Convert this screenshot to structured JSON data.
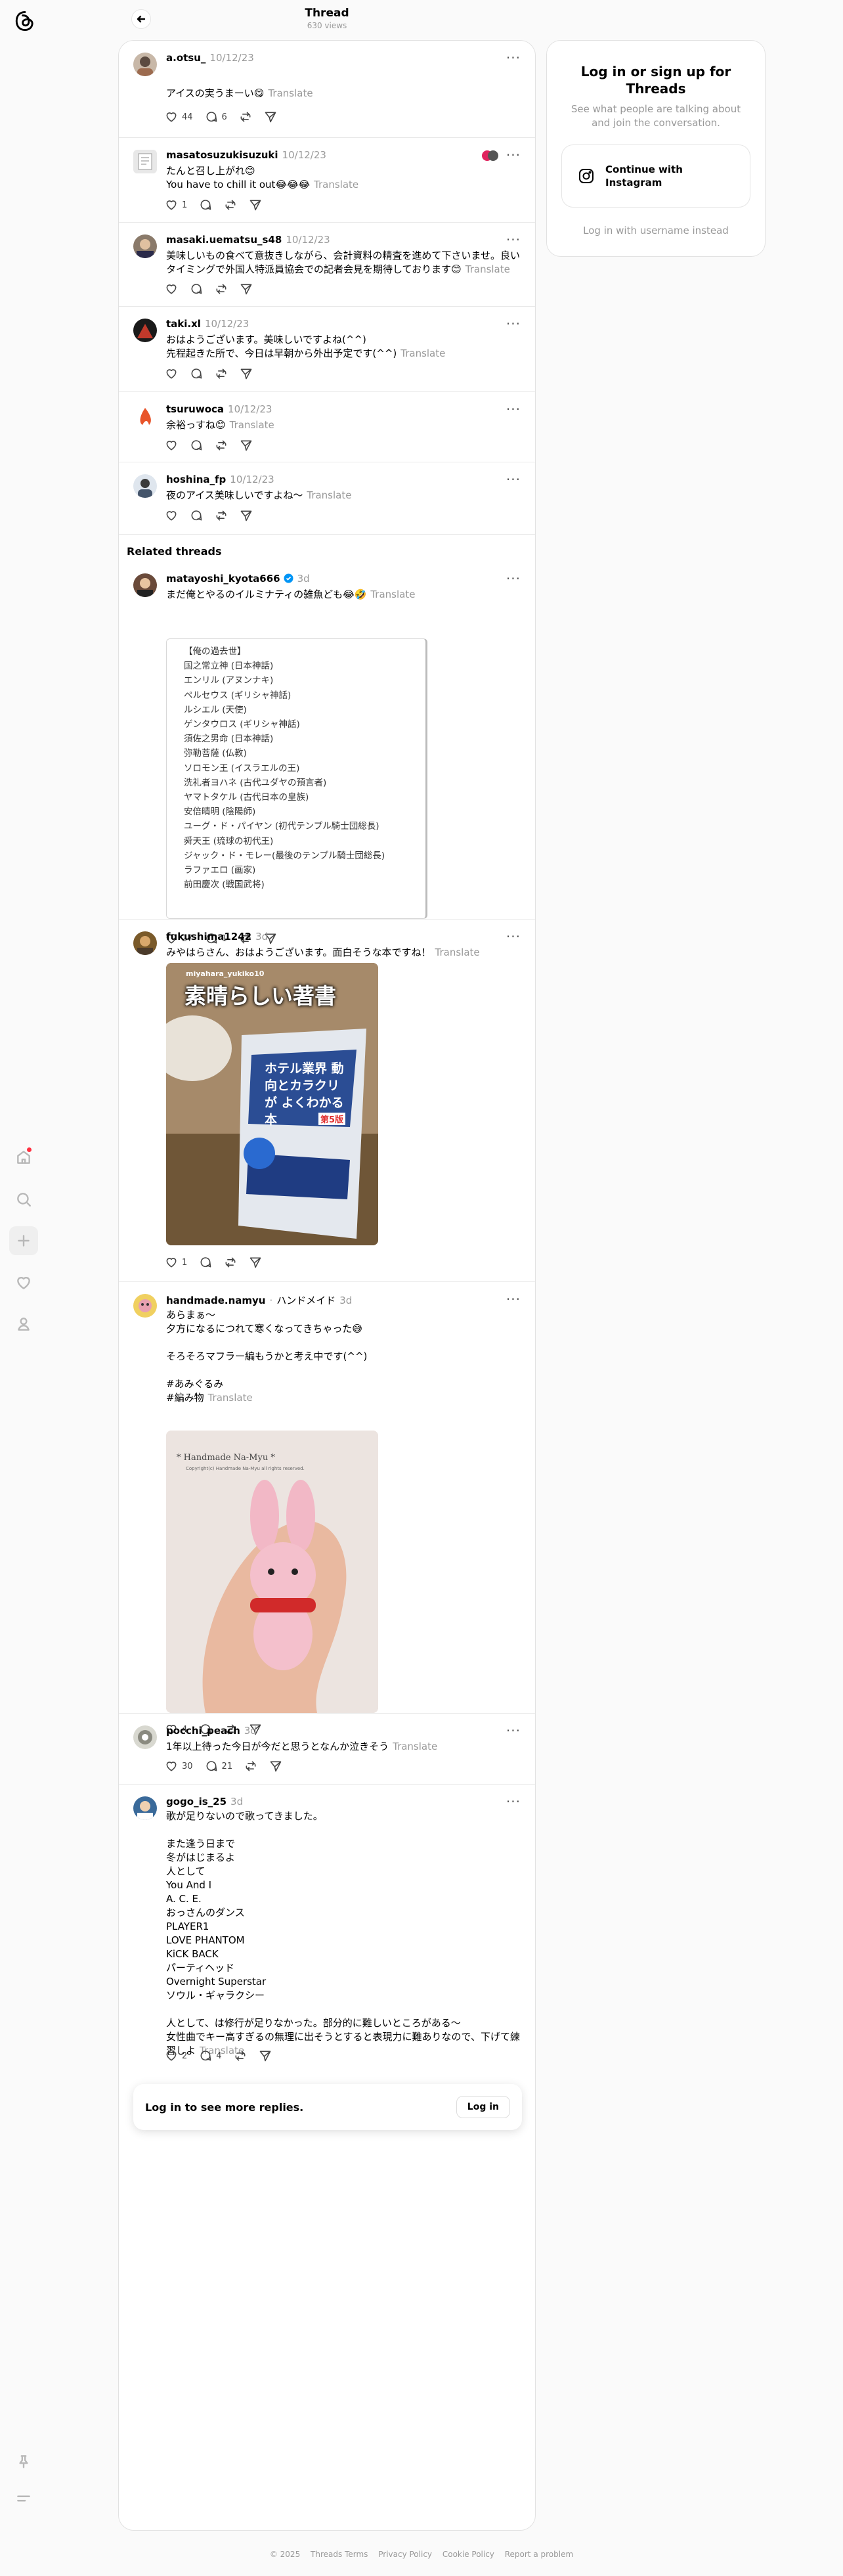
{
  "header": {
    "title": "Thread",
    "views": "630 views"
  },
  "side": {
    "title": "Log in or sign up for Threads",
    "subtitle": "See what people are talking about and join the conversation.",
    "ig_button": "Continue with Instagram",
    "alt": "Log in with username instead"
  },
  "translate": "Translate",
  "more": "···",
  "posts": [
    {
      "user": "a.otsu_",
      "date": "10/12/23",
      "text": "アイスの実うまーい😋",
      "likes": "44",
      "replies": "6"
    },
    {
      "user": "masatosuzukisuzuki",
      "date": "10/12/23",
      "text1": "たんと召し上がれ😊",
      "text2": "You have to chill it out😂😂😂",
      "likes": "1"
    },
    {
      "user": "masaki.uematsu_s48",
      "date": "10/12/23",
      "text1": "美味しいもの食べて意抜きしながら、会計資料の精査を進めて下さいませ。良い",
      "text2": "タイミングで外国人特派員協会での記者会見を期待しております😊"
    },
    {
      "user": "taki.xl",
      "date": "10/12/23",
      "text1": "おはようございます。美味しいですよね(^^)",
      "text2": "先程起きた所で、今日は早朝から外出予定です(^^)"
    },
    {
      "user": "tsuruwoca",
      "date": "10/12/23",
      "text": "余裕っすね😊"
    },
    {
      "user": "hoshina_fp",
      "date": "10/12/23",
      "text": "夜のアイス美味しいですよね〜"
    }
  ],
  "related_title": "Related threads",
  "related": [
    {
      "user": "matayoshi_kyota666",
      "date": "3d",
      "text": "まだ俺とやるのイルミナティの雑魚ども😂🤣",
      "list": [
        "【俺の過去世】",
        "国之常立神 (日本神話)",
        "エンリル (アヌンナキ)",
        "ペルセウス (ギリシャ神話)",
        "ルシエル (天使)",
        "ゲンタウロス (ギリシャ神話)",
        "須佐之男命 (日本神話)",
        "弥勒菩薩 (仏教)",
        "ソロモン王 (イスラエルの王)",
        "洗礼者ヨハネ (古代ユダヤの預言者)",
        "ヤマトタケル (古代日本の皇族)",
        "安倍晴明 (陰陽師)",
        "ユーグ・ド・パイヤン (初代テンプル騎士団総長)",
        "舜天王 (琉球の初代王)",
        "ジャック・ド・モレー(最後のテンプル騎士団総長)",
        "ラファエロ (画家)",
        "前田慶次 (戦国武将)"
      ],
      "likes": "27",
      "replies": "1"
    },
    {
      "user": "fukushima1242",
      "date": "3d",
      "text": "みやはらさん、おはようございます。面白そうな本ですね！",
      "img": {
        "top": "miyahara_yukiko10",
        "banner": "素晴らしい著書",
        "book": "ホテル業界 動向とカラクリが よくわかる本",
        "edition": "第5版"
      },
      "likes": "1"
    },
    {
      "user": "handmade.namyu",
      "tag": "ハンドメイド",
      "date": "3d",
      "lines": [
        "あらまぁ〜",
        "夕方になるにつれて寒くなってきちゃった😅",
        "",
        "そろそろマフラー編もうかと考え中です(^^)",
        "",
        "#あみぐるみ",
        "#編み物"
      ],
      "img": {
        "watermark": "* Handmade Na-Myu *",
        "copy": "Copyright(c) Handmade Na-Myu all rights reserved."
      },
      "likes": "4"
    },
    {
      "user": "pocchi_peach",
      "date": "3d",
      "text": "1年以上待った今日が今だと思うとなんか泣きそう",
      "likes": "30",
      "replies": "21"
    },
    {
      "user": "gogo_is_25",
      "date": "3d",
      "lines": [
        "歌が足りないので歌ってきました。",
        "",
        "また逢う日まで",
        "冬がはじまるよ",
        "人として",
        "You And I",
        "A. C. E.",
        "おっさんのダンス",
        "PLAYER1",
        "LOVE PHANTOM",
        "KiCK BACK",
        "パーティヘッド",
        "Overnight Superstar",
        "ソウル・ギャラクシー",
        "",
        "人として、は修行が足りなかった。部分的に難しいところがある〜",
        "女性曲でキー高すぎるの無理に出そうとすると表現力に難ありなので、下げて練",
        "習しよ"
      ],
      "likes": "2",
      "replies": "4"
    }
  ],
  "login_bar": {
    "text": "Log in to see more replies.",
    "button": "Log in"
  },
  "footer": {
    "copyright": "© 2025",
    "links": [
      "Threads Terms",
      "Privacy Policy",
      "Cookie Policy",
      "Report a problem"
    ]
  },
  "colors": {
    "muted": "#999999",
    "border": "#e2e2e2",
    "verified": "#0095f6",
    "notification": "#ff3040"
  }
}
